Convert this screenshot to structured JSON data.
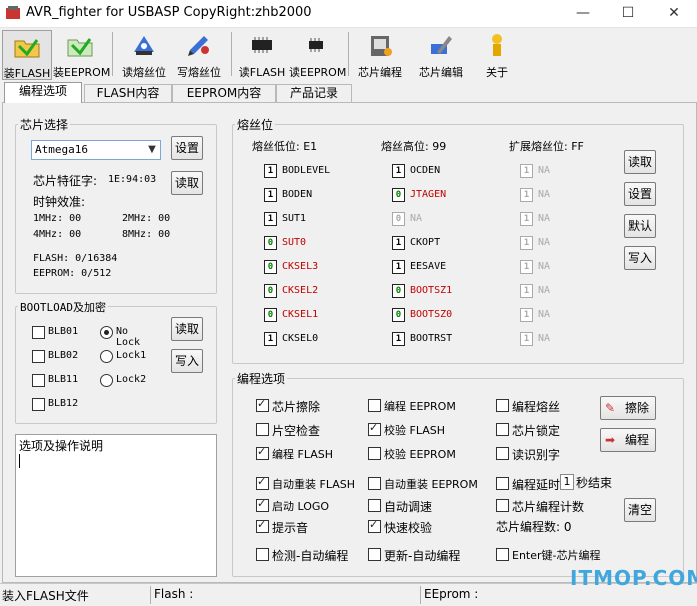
{
  "window": {
    "title": "AVR_fighter for USBASP CopyRight:zhb2000",
    "minimize": "—",
    "maximize": "☐",
    "close": "✕"
  },
  "toolbar": {
    "items": [
      {
        "label": "装FLASH",
        "icon": "folder-load-icon"
      },
      {
        "label": "装EEPROM",
        "icon": "folder-load-icon"
      },
      {
        "label": "读熔丝位",
        "icon": "read-fuse-icon"
      },
      {
        "label": "写熔丝位",
        "icon": "write-fuse-icon"
      },
      {
        "label": "读FLASH",
        "icon": "chip-icon"
      },
      {
        "label": "读EEPROM",
        "icon": "chip-icon"
      },
      {
        "label": "芯片编程",
        "icon": "program-chip-icon"
      },
      {
        "label": "芯片编辑",
        "icon": "edit-chip-icon"
      },
      {
        "label": "关于",
        "icon": "about-icon"
      }
    ]
  },
  "tabs": [
    "编程选项",
    "FLASH内容",
    "EEPROM内容",
    "产品记录"
  ],
  "chip": {
    "title": "芯片选择",
    "selected": "Atmega16",
    "set_btn": "设置",
    "read_btn": "读取",
    "signature_label": "芯片特征字:",
    "signature": "1E:94:03",
    "clock_label": "时钟效准:",
    "clocks": [
      "1MHz: 00",
      "2MHz: 00",
      "4MHz: 00",
      "8MHz: 00"
    ],
    "flash": "FLASH: 0/16384",
    "eeprom": "EEPROM: 0/512"
  },
  "boot": {
    "title": "BOOTLOAD及加密",
    "blb": [
      "BLB01",
      "BLB02",
      "BLB11",
      "BLB12"
    ],
    "locks": [
      "No Lock",
      "Lock1",
      "Lock2"
    ],
    "read_btn": "读取",
    "write_btn": "写入"
  },
  "notes": {
    "title": "选项及操作说明"
  },
  "fuse": {
    "title": "熔丝位",
    "low_label": "熔丝低位: E1",
    "high_label": "熔丝高位: 99",
    "ext_label": "扩展熔丝位: FF",
    "low": [
      {
        "v": "1",
        "n": "BODLEVEL",
        "s": "n"
      },
      {
        "v": "1",
        "n": "BODEN",
        "s": "n"
      },
      {
        "v": "1",
        "n": "SUT1",
        "s": "n"
      },
      {
        "v": "0",
        "n": "SUT0",
        "s": "r"
      },
      {
        "v": "0",
        "n": "CKSEL3",
        "s": "r"
      },
      {
        "v": "0",
        "n": "CKSEL2",
        "s": "r"
      },
      {
        "v": "0",
        "n": "CKSEL1",
        "s": "r"
      },
      {
        "v": "1",
        "n": "CKSEL0",
        "s": "n"
      }
    ],
    "high": [
      {
        "v": "1",
        "n": "OCDEN",
        "s": "n"
      },
      {
        "v": "0",
        "n": "JTAGEN",
        "s": "r"
      },
      {
        "v": "0",
        "n": "NA",
        "s": "d"
      },
      {
        "v": "1",
        "n": "CKOPT",
        "s": "n"
      },
      {
        "v": "1",
        "n": "EESAVE",
        "s": "n"
      },
      {
        "v": "0",
        "n": "BOOTSZ1",
        "s": "r"
      },
      {
        "v": "0",
        "n": "BOOTSZ0",
        "s": "r"
      },
      {
        "v": "1",
        "n": "BOOTRST",
        "s": "n"
      }
    ],
    "ext": [
      {
        "v": "1",
        "n": "NA",
        "s": "d"
      },
      {
        "v": "1",
        "n": "NA",
        "s": "d"
      },
      {
        "v": "1",
        "n": "NA",
        "s": "d"
      },
      {
        "v": "1",
        "n": "NA",
        "s": "d"
      },
      {
        "v": "1",
        "n": "NA",
        "s": "d"
      },
      {
        "v": "1",
        "n": "NA",
        "s": "d"
      },
      {
        "v": "1",
        "n": "NA",
        "s": "d"
      },
      {
        "v": "1",
        "n": "NA",
        "s": "d"
      }
    ],
    "buttons": [
      "读取",
      "设置",
      "默认",
      "写入"
    ]
  },
  "prog": {
    "title": "编程选项",
    "rows": [
      [
        {
          "l": "芯片擦除",
          "c": true
        },
        {
          "l": "编程 EEPROM",
          "c": false
        },
        {
          "l": "编程熔丝",
          "c": false
        }
      ],
      [
        {
          "l": "片空检查",
          "c": false
        },
        {
          "l": "校验 FLASH",
          "c": true
        },
        {
          "l": "芯片锁定",
          "c": false
        }
      ],
      [
        {
          "l": "编程 FLASH",
          "c": true
        },
        {
          "l": "校验 EEPROM",
          "c": false
        },
        {
          "l": "读识别字",
          "c": false
        }
      ],
      [
        {
          "l": "自动重装 FLASH",
          "c": true
        },
        {
          "l": "自动重装 EEPROM",
          "c": false
        },
        {
          "l": "编程延时",
          "c": false
        }
      ],
      [
        {
          "l": "启动 LOGO",
          "c": true
        },
        {
          "l": "自动调速",
          "c": false
        },
        {
          "l": "芯片编程计数",
          "c": false
        }
      ],
      [
        {
          "l": "提示音",
          "c": true
        },
        {
          "l": "快速校验",
          "c": true
        }
      ],
      [
        {
          "l": "检测-自动编程",
          "c": false
        },
        {
          "l": "更新-自动编程",
          "c": false
        },
        {
          "l": "Enter键-芯片编程",
          "c": false
        }
      ]
    ],
    "delay_value": "1",
    "delay_suffix": "秒结束",
    "count_label": "芯片编程数: 0",
    "erase_btn": "擦除",
    "program_btn": "编程",
    "clear_btn": "清空"
  },
  "status": {
    "left": "装入FLASH文件",
    "flash": "Flash :",
    "eeprom": "EEprom :"
  },
  "watermark": "ITMOP.COM"
}
